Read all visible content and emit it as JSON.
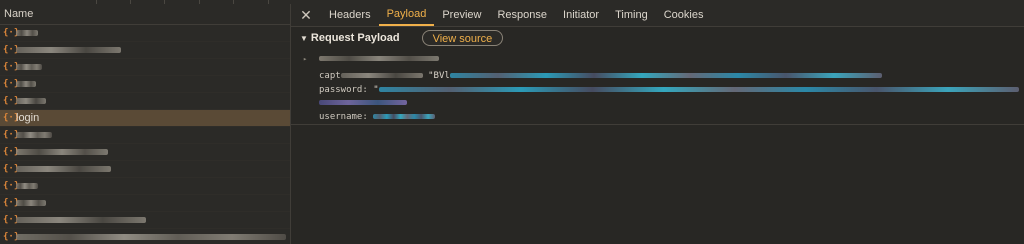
{
  "network_panel": {
    "name_column_header": "Name",
    "requests": [
      {
        "name": "",
        "icon": "json-icon",
        "selected": false
      },
      {
        "name": "",
        "icon": "json-icon",
        "selected": false
      },
      {
        "name": "",
        "icon": "json-icon",
        "selected": false
      },
      {
        "name": "",
        "icon": "json-icon",
        "selected": false
      },
      {
        "name": "",
        "icon": "json-icon",
        "selected": false
      },
      {
        "name": "login",
        "icon": "json-icon",
        "selected": true
      },
      {
        "name": "",
        "icon": "json-icon",
        "selected": false
      },
      {
        "name": "",
        "icon": "json-icon",
        "selected": false
      },
      {
        "name": "",
        "icon": "json-icon",
        "selected": false
      },
      {
        "name": "",
        "icon": "json-icon",
        "selected": false
      },
      {
        "name": "",
        "icon": "json-icon",
        "selected": false
      },
      {
        "name": "",
        "icon": "json-icon",
        "selected": false
      },
      {
        "name": "",
        "icon": "json-icon",
        "selected": false
      }
    ]
  },
  "details": {
    "close_label": "✕",
    "tabs": [
      "Headers",
      "Payload",
      "Preview",
      "Response",
      "Initiator",
      "Timing",
      "Cookies"
    ],
    "active_tab": "Payload",
    "section_title": "Request Payload",
    "view_source_label": "View source",
    "payload_fields": [
      {
        "key": "capt",
        "value_prefix": "\"BVl"
      },
      {
        "key": "password:",
        "value_prefix": "\""
      },
      {
        "key": "username:",
        "value_prefix": ""
      }
    ]
  },
  "colors": {
    "accent": "#f0b04a",
    "selected_row": "#5a4a36",
    "json_icon": "#e0883a",
    "background": "#282724"
  }
}
